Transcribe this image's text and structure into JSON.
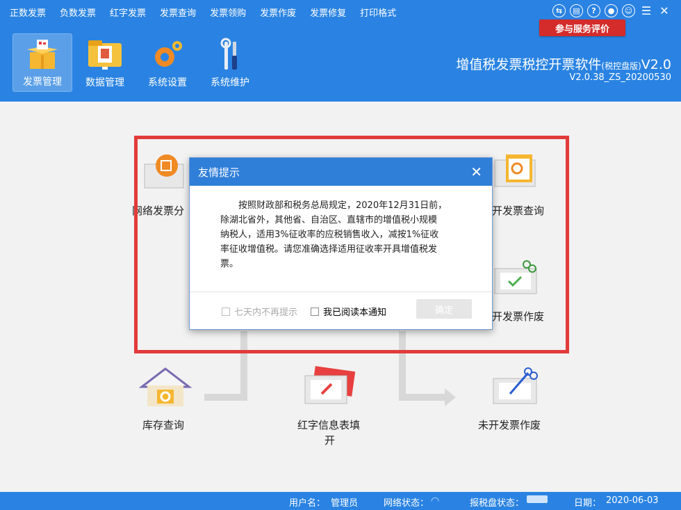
{
  "menu": {
    "items": [
      "正数发票",
      "负数发票",
      "红字发票",
      "发票查询",
      "发票领购",
      "发票作废",
      "发票修复",
      "打印格式"
    ]
  },
  "top_icons": [
    "switch-icon",
    "clipboard-icon",
    "help-icon",
    "lock-icon",
    "user-icon",
    "hamburger-icon",
    "close-icon"
  ],
  "rate_button": "参与服务评价",
  "toolbar": {
    "items": [
      {
        "label": "发票管理",
        "icon": "box-icon",
        "active": true
      },
      {
        "label": "数据管理",
        "icon": "folder-icon",
        "active": false
      },
      {
        "label": "系统设置",
        "icon": "gear-icon",
        "active": false
      },
      {
        "label": "系统维护",
        "icon": "tools-icon",
        "active": false
      }
    ]
  },
  "app": {
    "title": "增值税发票税控开票软件",
    "edition": "(税控盘版)",
    "version_suffix": "V2.0",
    "build": "V2.0.38_ZS_20200530"
  },
  "flow": {
    "network_invoice": "网络发票分",
    "issued_query": "开发票查询",
    "issued_void": "开发票作废",
    "stock_query": "库存查询",
    "red_info": "红字信息表填",
    "red_info_2": "开",
    "unissued_void": "未开发票作废"
  },
  "dialog": {
    "title": "友情提示",
    "close": "✕",
    "message_lines": [
      "按照财政部和税务总局规定，2020年12月31日前，",
      "除湖北省外，其他省、自治区、直辖市的增值税小规模",
      "纳税人，适用3%征收率的应税销售收入，减按1%征收",
      "率征收增值税。请您准确选择适用征收率开具增值税发",
      "票。"
    ],
    "checkbox_7days": "七天内不再提示",
    "checkbox_read": "我已阅读本通知",
    "ok": "确定"
  },
  "status": {
    "user_label": "用户名：",
    "user": "管理员",
    "network_label": "网络状态：",
    "disk_label": "报税盘状态：",
    "date_label": "日期：",
    "date": "2020-06-03"
  },
  "colors": {
    "header_blue": "#2a83e2",
    "dialog_blue": "#2f7ed8",
    "alert_red": "#e23b3b",
    "rate_red": "#d42b2b"
  }
}
